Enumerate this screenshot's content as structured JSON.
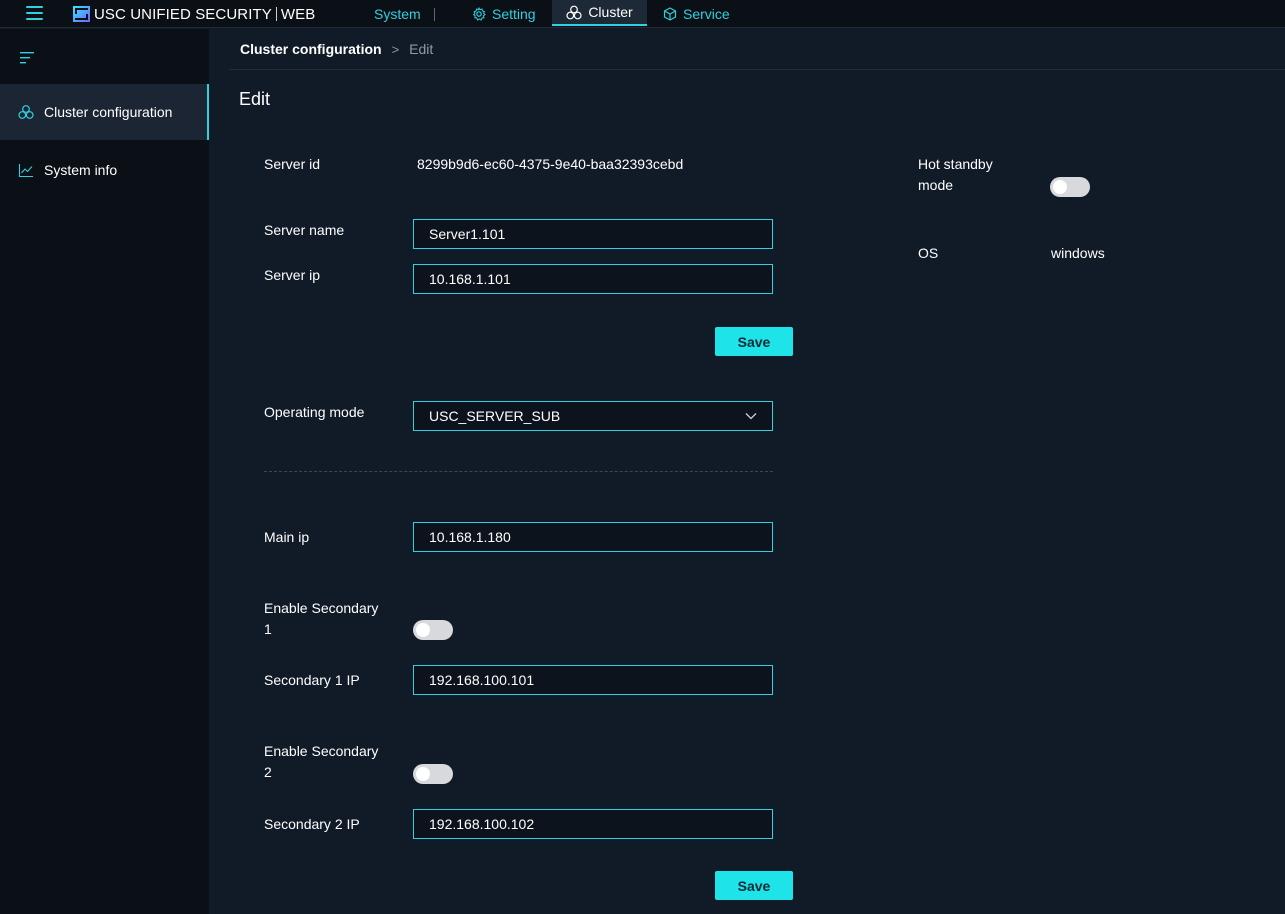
{
  "header": {
    "logo_text": "USC UNIFIED SECURITY",
    "logo_suffix": "WEB",
    "nav_system": "System",
    "nav_setting": "Setting",
    "nav_cluster": "Cluster",
    "nav_service": "Service"
  },
  "sidebar": {
    "items": [
      {
        "label": "Cluster configuration",
        "icon": "cluster-icon",
        "active": true
      },
      {
        "label": "System info",
        "icon": "line-chart-icon",
        "active": false
      }
    ]
  },
  "breadcrumb": {
    "parent": "Cluster configuration",
    "separator": ">",
    "current": "Edit"
  },
  "page": {
    "title": "Edit"
  },
  "form": {
    "server_id_label": "Server id",
    "server_id_value": "8299b9d6-ec60-4375-9e40-baa32393cebd",
    "server_name_label": "Server name",
    "server_name_value": "Server1.101",
    "server_ip_label": "Server ip",
    "server_ip_value": "10.168.1.101",
    "save_label": "Save",
    "operating_mode_label": "Operating mode",
    "operating_mode_value": "USC_SERVER_SUB",
    "main_ip_label": "Main ip",
    "main_ip_value": "10.168.1.180",
    "enable_secondary1_label_line1": "Enable Secondary",
    "enable_secondary1_label_line2": "1",
    "enable_secondary1_on": false,
    "secondary1_ip_label": "Secondary 1 IP",
    "secondary1_ip_value": "192.168.100.101",
    "enable_secondary2_label_line1": "Enable Secondary",
    "enable_secondary2_label_line2": "2",
    "enable_secondary2_on": false,
    "secondary2_ip_label": "Secondary 2 IP",
    "secondary2_ip_value": "192.168.100.102",
    "save2_label": "Save"
  },
  "info": {
    "hot_standby_label_line1": "Hot standby",
    "hot_standby_label_line2": "mode",
    "hot_standby_on": false,
    "os_label": "OS",
    "os_value": "windows"
  },
  "colors": {
    "accent": "#2fd0e0",
    "button": "#1ee3e8",
    "background": "#111a27",
    "sidebar": "#0b0f16"
  }
}
